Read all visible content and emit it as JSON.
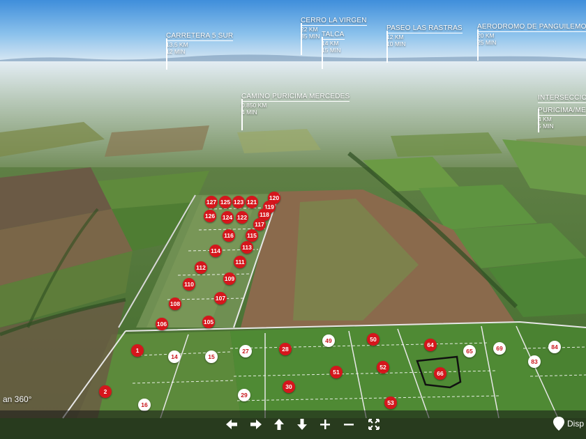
{
  "points_of_interest": [
    {
      "name": "CARRETERA 5 SUR",
      "distance": "13.5 KM",
      "time": "12 MIN"
    },
    {
      "name": "CERRO LA VIRGEN",
      "distance": "22 KM",
      "time": "35 MIN"
    },
    {
      "name": "TALCA",
      "distance": "14 KM",
      "time": "15 MIN"
    },
    {
      "name": "PASEO LAS RASTRAS",
      "distance": "12 KM",
      "time": "10 MIN"
    },
    {
      "name": "AERODROMO DE PANGUILEMO",
      "distance": "20 KM",
      "time": "25 MIN"
    },
    {
      "name": "CAMINO PURICIMA MERCEDES",
      "distance": "0.850 KM",
      "time": "4 MIN"
    },
    {
      "name": "INTERSECCION",
      "name2": "PURICIMA/ME",
      "distance": "4 KM",
      "time": "5 MIN"
    }
  ],
  "lots": [
    {
      "label": "127",
      "status": "sold"
    },
    {
      "label": "125",
      "status": "sold"
    },
    {
      "label": "123",
      "status": "sold"
    },
    {
      "label": "121",
      "status": "sold"
    },
    {
      "label": "120",
      "status": "sold"
    },
    {
      "label": "119",
      "status": "sold"
    },
    {
      "label": "126",
      "status": "sold"
    },
    {
      "label": "124",
      "status": "sold"
    },
    {
      "label": "122",
      "status": "sold"
    },
    {
      "label": "118",
      "status": "sold"
    },
    {
      "label": "117",
      "status": "sold"
    },
    {
      "label": "116",
      "status": "sold"
    },
    {
      "label": "115",
      "status": "sold"
    },
    {
      "label": "113",
      "status": "sold"
    },
    {
      "label": "114",
      "status": "sold"
    },
    {
      "label": "111",
      "status": "sold"
    },
    {
      "label": "112",
      "status": "sold"
    },
    {
      "label": "109",
      "status": "sold"
    },
    {
      "label": "110",
      "status": "sold"
    },
    {
      "label": "107",
      "status": "sold"
    },
    {
      "label": "108",
      "status": "sold"
    },
    {
      "label": "105",
      "status": "sold"
    },
    {
      "label": "106",
      "status": "sold"
    },
    {
      "label": "1",
      "status": "sold"
    },
    {
      "label": "14",
      "status": "available"
    },
    {
      "label": "15",
      "status": "available"
    },
    {
      "label": "27",
      "status": "available"
    },
    {
      "label": "28",
      "status": "sold"
    },
    {
      "label": "49",
      "status": "available"
    },
    {
      "label": "50",
      "status": "sold"
    },
    {
      "label": "64",
      "status": "sold"
    },
    {
      "label": "65",
      "status": "available"
    },
    {
      "label": "69",
      "status": "available"
    },
    {
      "label": "84",
      "status": "available"
    },
    {
      "label": "83",
      "status": "available"
    },
    {
      "label": "51",
      "status": "sold"
    },
    {
      "label": "52",
      "status": "sold"
    },
    {
      "label": "66",
      "status": "sold"
    },
    {
      "label": "30",
      "status": "sold"
    },
    {
      "label": "29",
      "status": "available"
    },
    {
      "label": "2",
      "status": "sold"
    },
    {
      "label": "16",
      "status": "available"
    },
    {
      "label": "53",
      "status": "sold"
    }
  ],
  "toolbar": {
    "tour_label": "an 360°",
    "availability_label": "Disp",
    "buttons": [
      {
        "icon": "arrow-left-icon",
        "action": "pan-left"
      },
      {
        "icon": "arrow-right-icon",
        "action": "pan-right"
      },
      {
        "icon": "arrow-up-icon",
        "action": "pan-up"
      },
      {
        "icon": "arrow-down-icon",
        "action": "pan-down"
      },
      {
        "icon": "plus-icon",
        "action": "zoom-in"
      },
      {
        "icon": "minus-icon",
        "action": "zoom-out"
      },
      {
        "icon": "fullscreen-icon",
        "action": "fullscreen"
      }
    ]
  },
  "colors": {
    "sold": "#d5161c",
    "available": "#ffffff",
    "sky_top": "#4a9be0",
    "haze": "#e8f0f6",
    "field_green": "#5d8f3a",
    "field_brown": "#7a5b3f"
  }
}
